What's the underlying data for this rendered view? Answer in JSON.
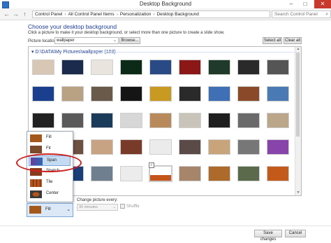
{
  "window": {
    "title": "Desktop Background",
    "minimize": "–",
    "maximize": "□",
    "close": "✕"
  },
  "nav": {
    "back": "←",
    "forward": "→",
    "up": "↑",
    "breadcrumb": [
      "Control Panel",
      "All Control Panel Items",
      "Personalization",
      "Desktop Background"
    ],
    "separator": "›",
    "search_placeholder": "Search Control Panel",
    "search_icon": "search-icon"
  },
  "main": {
    "title": "Choose your desktop background",
    "subtitle": "Click a picture to make it your desktop background, or select more than one picture to create a slide show.",
    "location_label": "Picture location:",
    "location_value": "wallpaper",
    "browse_label": "Browse...",
    "select_all_label": "Select all",
    "clear_all_label": "Clear all"
  },
  "gallery": {
    "group_header": "▾ D:\\DATA\\My Pictures\\wallpaper (103)",
    "selected_check": "✓",
    "thumbs": [
      {
        "color": "#d8c7b4"
      },
      {
        "color": "#1a2b4d"
      },
      {
        "color": "#e9e4de"
      },
      {
        "color": "#0b2b18"
      },
      {
        "color": "#2a4a86"
      },
      {
        "color": "#8b1717"
      },
      {
        "color": "#1f3a2a"
      },
      {
        "color": "#2a2a2a"
      },
      {
        "color": "#555555"
      },
      {
        "color": "#1b3f8f"
      },
      {
        "color": "#b9a183"
      },
      {
        "color": "#6a5a4a"
      },
      {
        "color": "#151515"
      },
      {
        "color": "#c89a22"
      },
      {
        "color": "#2a2a2a"
      },
      {
        "color": "#3f6fb4"
      },
      {
        "color": "#8a4a2a"
      },
      {
        "color": "#4a7ab4"
      },
      {
        "color": "#222222"
      },
      {
        "color": "#5a5a5a"
      },
      {
        "color": "#1b3b5b"
      },
      {
        "color": "#d7d7d7"
      },
      {
        "color": "#b88a5b"
      },
      {
        "color": "#c9c4b9"
      },
      {
        "color": "#1f1f1f"
      },
      {
        "color": "#6a6a6a"
      },
      {
        "color": "#bba68a"
      },
      {
        "color": "#1a1a1a"
      },
      {
        "color": "#6d5040"
      },
      {
        "color": "#c8a383"
      },
      {
        "color": "#7a3a2a"
      },
      {
        "color": "#ebebeb"
      },
      {
        "color": "#5a4a48"
      },
      {
        "color": "#c7a47a"
      },
      {
        "color": "#777777"
      },
      {
        "color": "#8844aa"
      },
      {
        "color": "#2a2a2a"
      },
      {
        "color": "#1a3e7a"
      },
      {
        "color": "#6f7f90"
      },
      {
        "color": "#ececec"
      },
      {
        "color": "#ffffff"
      },
      {
        "color": "#a6856a"
      },
      {
        "color": "#ad6a2a"
      },
      {
        "color": "#5a6a4a"
      },
      {
        "color": "#c45a1a"
      }
    ]
  },
  "fit": {
    "options": [
      "Fill",
      "Fit",
      "Span",
      "Stretch",
      "Tile",
      "Center"
    ],
    "active": "Span",
    "current": "Fill",
    "dropdown_arrow": "⌄"
  },
  "slideshow": {
    "change_label": "Change picture every:",
    "interval_value": "30 minutes",
    "shuffle_label": "Shuffle",
    "arrow": "⌄"
  },
  "footer": {
    "save_label": "Save changes",
    "cancel_label": "Cancel"
  }
}
